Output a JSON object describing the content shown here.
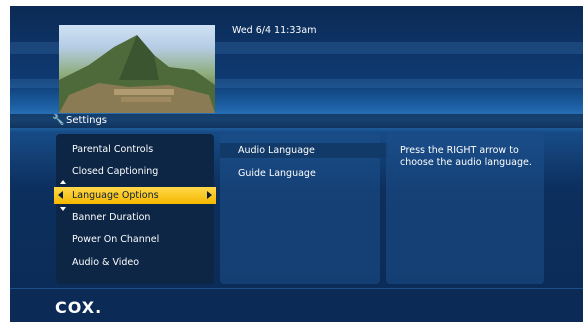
{
  "header": {
    "datetime": "Wed 6/4  11:33am"
  },
  "title": {
    "icon": "wrench-icon",
    "label": "Settings"
  },
  "menu": {
    "items": [
      {
        "label": "Parental Controls"
      },
      {
        "label": "Closed Captioning"
      },
      {
        "label": "Language Options",
        "selected": true
      },
      {
        "label": "Banner Duration"
      },
      {
        "label": "Power On Channel"
      },
      {
        "label": "Audio & Video"
      }
    ]
  },
  "submenu": {
    "items": [
      {
        "label": "Audio Language",
        "highlighted": true
      },
      {
        "label": "Guide Language"
      }
    ]
  },
  "help": {
    "text": "Press the RIGHT arrow to choose the audio language."
  },
  "footer": {
    "logo": "COX."
  },
  "colors": {
    "selection": "#f6b800",
    "panel": "#0d2646",
    "background": "#0f3b73"
  }
}
